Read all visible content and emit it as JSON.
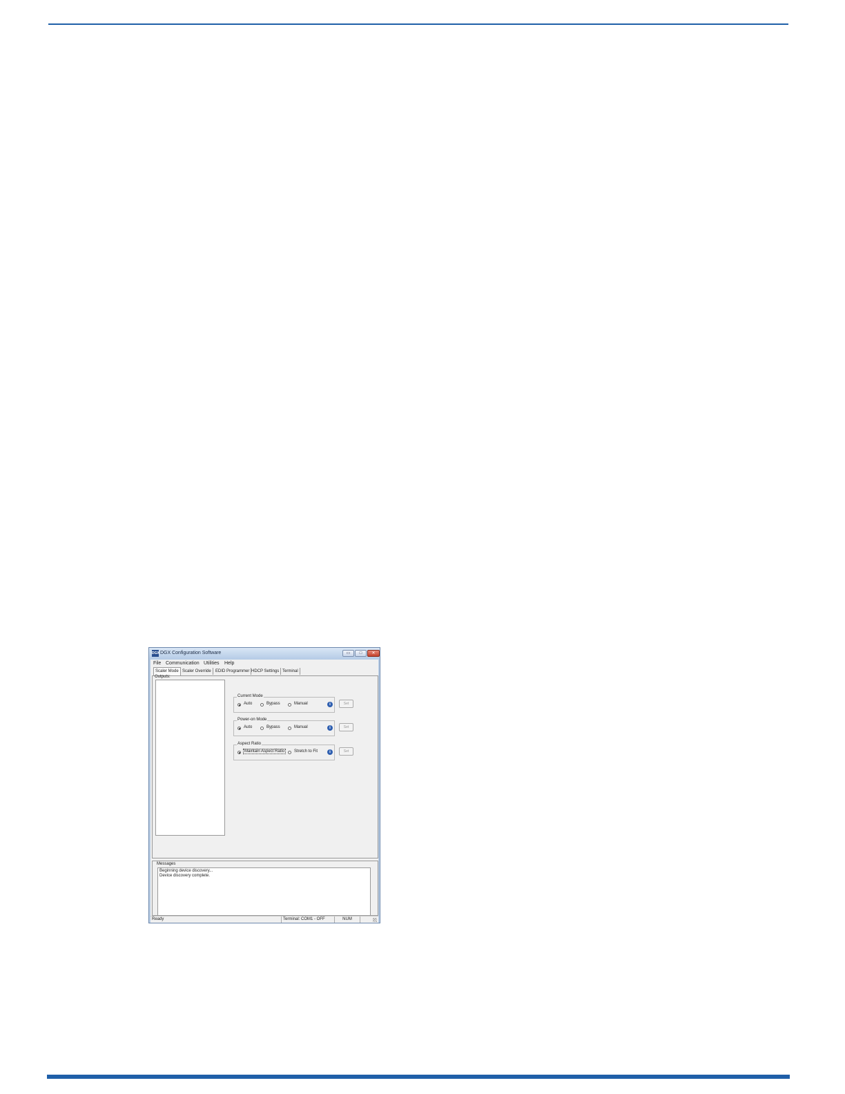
{
  "window": {
    "title": "DGX Configuration Software",
    "icon_text": "DGX",
    "minimize_label": "▭",
    "maximize_label": "□",
    "close_label": "✕"
  },
  "menu": [
    "File",
    "Communication",
    "Utilities",
    "Help"
  ],
  "tabs": [
    "Scaler Mode",
    "Scaler Override",
    "EDID Programmer",
    "HDCP Settings",
    "Terminal"
  ],
  "active_tab": "Scaler Mode",
  "outputs": {
    "label": "Outputs:"
  },
  "groups": {
    "current_mode": {
      "title": "Current Mode",
      "options": [
        "Auto",
        "Bypass",
        "Manual"
      ],
      "selected": "Auto",
      "button": "Set"
    },
    "power_on_mode": {
      "title": "Power-on Mode",
      "options": [
        "Auto",
        "Bypass",
        "Manual"
      ],
      "selected": "Auto",
      "button": "Set"
    },
    "aspect_ratio": {
      "title": "Aspect Ratio",
      "options": [
        "Maintain Aspect Ratio",
        "Stretch to Fit"
      ],
      "selected": "Maintain Aspect Ratio",
      "button": "Set"
    }
  },
  "messages": {
    "label": "Messages",
    "lines": [
      "Beginning device discovery...",
      "Device discovery complete."
    ]
  },
  "status": {
    "ready": "Ready",
    "terminal": "Terminal: COM1 - OFF",
    "num": "NUM"
  },
  "colors": {
    "accent_rule": "#1f5fa8",
    "titlebar": "#b9cde5",
    "close_button": "#c4412d"
  }
}
